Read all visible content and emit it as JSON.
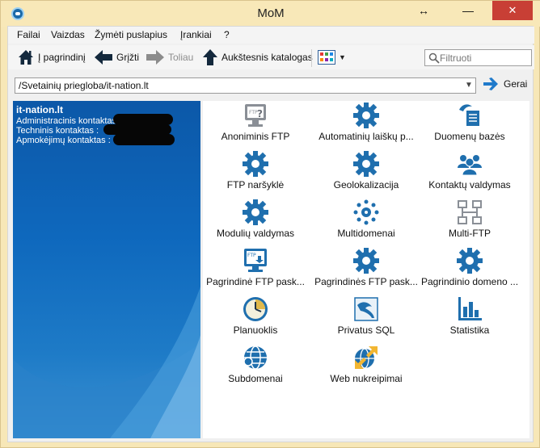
{
  "window": {
    "title": "MoM",
    "close_symbol": "✕",
    "min_symbol": "—",
    "max_symbol": "☐",
    "resize_symbol": "↔"
  },
  "menu": [
    "Failai",
    "Vaizdas",
    "Žymėti puslapius",
    "Įrankiai",
    "?"
  ],
  "toolbar": {
    "home_label": "Į pagrindinį",
    "back_label": "Grįžti",
    "forward_label": "Toliau",
    "up_label": "Aukštesnis katalogas",
    "search_placeholder": "Filtruoti"
  },
  "address": {
    "path": "/Svetainių priegloba/it-nation.lt",
    "go_label": "Gerai"
  },
  "info": {
    "domain": "it-nation.lt",
    "admin_contact": "Administracinis kontaktas :",
    "tech_contact": "Techninis kontaktas :",
    "billing_contact": "Apmokėjimų kontaktas :"
  },
  "items": [
    {
      "label": "Anoniminis FTP",
      "icon": "anonymous-ftp-icon"
    },
    {
      "label": "Automatinių laiškų p...",
      "icon": "gear-icon"
    },
    {
      "label": "Duomenų bazės",
      "icon": "database-icon"
    },
    {
      "label": "FTP naršyklė",
      "icon": "gear-icon"
    },
    {
      "label": "Geolokalizacija",
      "icon": "gear-icon"
    },
    {
      "label": "Kontaktų valdymas",
      "icon": "contacts-icon"
    },
    {
      "label": "Modulių valdymas",
      "icon": "gear-icon"
    },
    {
      "label": "Multidomenai",
      "icon": "multidomain-icon"
    },
    {
      "label": "Multi-FTP",
      "icon": "multi-ftp-icon"
    },
    {
      "label": "Pagrindinė FTP pask...",
      "icon": "ftp-account-icon"
    },
    {
      "label": "Pagrindinės FTP pask...",
      "icon": "gear-icon"
    },
    {
      "label": "Pagrindinio domeno ...",
      "icon": "gear-icon"
    },
    {
      "label": "Planuoklis",
      "icon": "clock-icon"
    },
    {
      "label": "Privatus SQL",
      "icon": "private-sql-icon"
    },
    {
      "label": "Statistika",
      "icon": "statistics-icon"
    },
    {
      "label": "Subdomenai",
      "icon": "globe-icon"
    },
    {
      "label": "Web nukreipimai",
      "icon": "web-redirect-icon"
    }
  ],
  "colors": {
    "accent": "#1f6fae",
    "panel_blue": "#0e63b6",
    "title_bar": "#f8e8b8",
    "close": "#c83f35"
  }
}
